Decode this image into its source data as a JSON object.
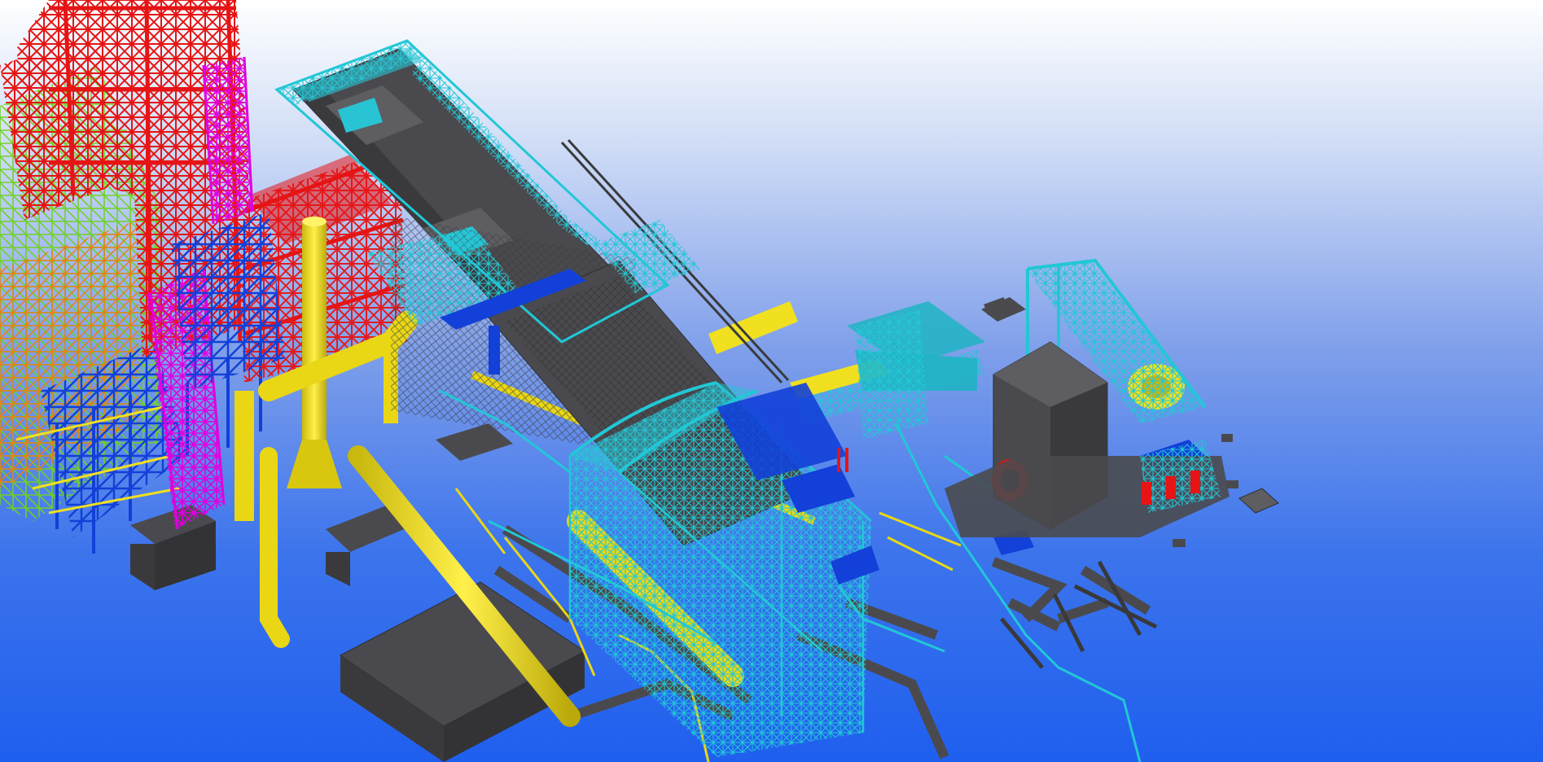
{
  "viewport": {
    "view": "3D model view",
    "background": {
      "top": "#ffffff",
      "bottom": "#1f5fee"
    }
  },
  "model_colors": {
    "concrete": "#4a4a4e",
    "concrete_top": "#5e5e62",
    "concrete_side": "#3a3a3d",
    "steel_primary": "#e61414",
    "steel_bracing": "#e000e0",
    "steel_secondary": "#22c7d6",
    "steel_tertiary": "#1240d8",
    "pipework": "#f0e020",
    "steel_green": "#6fd21e",
    "steel_orange": "#f07a10",
    "equipment": "#1fb4c4"
  }
}
